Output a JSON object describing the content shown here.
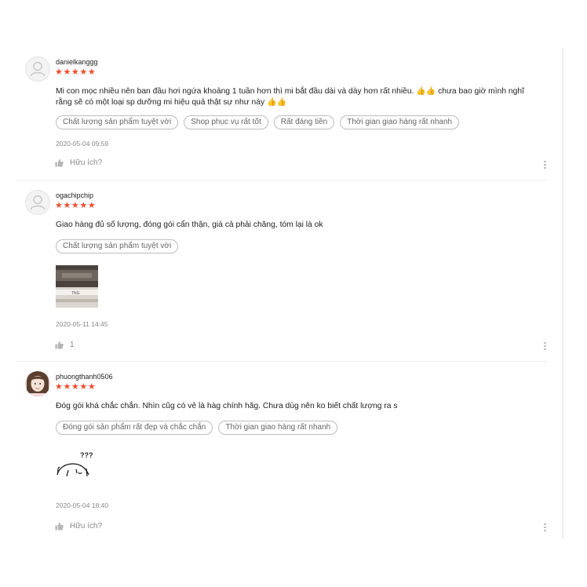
{
  "reviews": [
    {
      "username": "danielkanggg",
      "stars": "★★★★★",
      "comment_line1": "Mi con mọc nhiều nên ban đầu hơi ngứa khoảng 1 tuần hơn thì mi bắt đầu dài và dày hơn rất nhiều.",
      "comment_line1_tail": "chưa bao giờ mình nghĩ",
      "comment_line2": "rằng sẽ có một loại sp dưỡng mi hiệu quả thật sự như này",
      "tags": [
        "Chất lượng sản phẩm tuyệt vời",
        "Shop phục vụ rất tốt",
        "Rất đáng tiền",
        "Thời gian giao hàng rất nhanh"
      ],
      "timestamp": "2020-05-04 09:59",
      "like_label": "Hữu ích?"
    },
    {
      "username": "ogachipchip",
      "stars": "★★★★★",
      "comment_line1": "Giao hàng đủ số lượng, đóng gói cẩn thận, giá cả phải chăng, tóm lại là ok",
      "tags": [
        "Chất lượng sản phẩm tuyệt vời"
      ],
      "photo_label": "TNG",
      "timestamp": "2020-05-11 14:45",
      "like_label": "1"
    },
    {
      "username": "phuongthanh0506",
      "stars": "★★★★★",
      "comment_line1": "Đóg gói khá chắc chắn. Nhìn cũg có vẻ là hàg chính hãg. Chưa dùg nên ko biết chất lượng ra s",
      "tags": [
        "Đóng gói sản phẩm rất đẹp và chắc chắn",
        "Thời gian giao hàng rất nhanh"
      ],
      "sticker_text": "???",
      "timestamp": "2020-05-04 18:40",
      "like_label": "Hữu ích?"
    }
  ],
  "colors": {
    "star": "#ee4d2d",
    "tag_border": "#bdbdbd",
    "muted": "#888888"
  },
  "icons": {
    "like": "thumbs-up-icon",
    "more": "more-vertical-icon",
    "emoji": "thumbs-up-emoji-icon"
  }
}
